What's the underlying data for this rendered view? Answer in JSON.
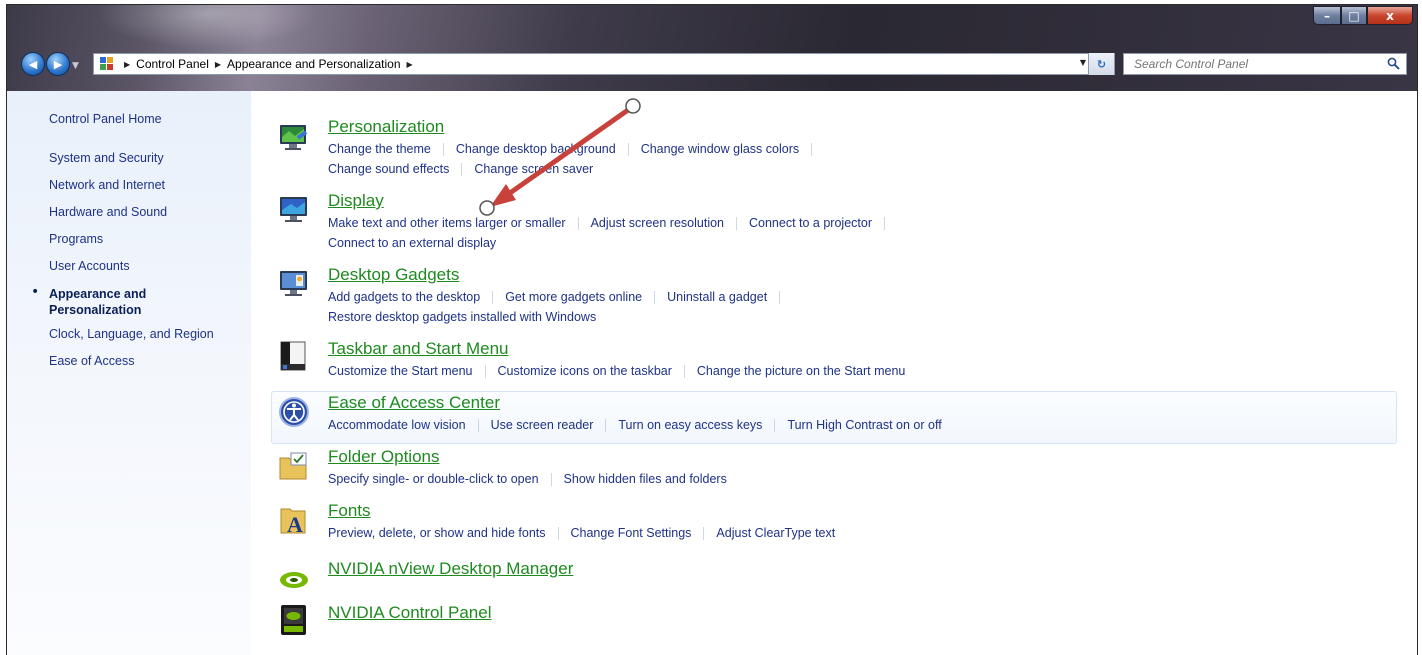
{
  "window": {
    "caption_buttons": {
      "minimize": "–",
      "maximize": "□",
      "close": "x"
    }
  },
  "nav": {
    "back_glyph": "◀",
    "forward_glyph": "▶",
    "breadcrumbs": [
      "Control Panel",
      "Appearance and Personalization"
    ],
    "refresh_glyph": "↻",
    "search_placeholder": "Search Control Panel"
  },
  "sidebar": {
    "items": [
      {
        "label": "Control Panel Home"
      },
      {
        "label": "System and Security"
      },
      {
        "label": "Network and Internet"
      },
      {
        "label": "Hardware and Sound"
      },
      {
        "label": "Programs"
      },
      {
        "label": "User Accounts"
      },
      {
        "label_line1": "Appearance and",
        "label_line2": "Personalization",
        "current": true
      },
      {
        "label": "Clock, Language, and Region"
      },
      {
        "label": "Ease of Access"
      }
    ],
    "bullet": "•"
  },
  "categories": [
    {
      "title": "Personalization",
      "icon": "personalization-icon",
      "links_row1": [
        "Change the theme",
        "Change desktop background",
        "Change window glass colors"
      ],
      "links_row2": [
        "Change sound effects",
        "Change screen saver"
      ]
    },
    {
      "title": "Display",
      "icon": "display-icon",
      "links_row1": [
        "Make text and other items larger or smaller",
        "Adjust screen resolution",
        "Connect to a projector"
      ],
      "links_row2": [
        "Connect to an external display"
      ]
    },
    {
      "title": "Desktop Gadgets",
      "icon": "gadgets-icon",
      "links_row1": [
        "Add gadgets to the desktop",
        "Get more gadgets online",
        "Uninstall a gadget"
      ],
      "links_row2": [
        "Restore desktop gadgets installed with Windows"
      ]
    },
    {
      "title": "Taskbar and Start Menu",
      "icon": "taskbar-icon",
      "links_row1": [
        "Customize the Start menu",
        "Customize icons on the taskbar",
        "Change the picture on the Start menu"
      ]
    },
    {
      "title": "Ease of Access Center",
      "icon": "ease-of-access-icon",
      "links_row1": [
        "Accommodate low vision",
        "Use screen reader",
        "Turn on easy access keys",
        "Turn High Contrast on or off"
      ]
    },
    {
      "title": "Folder Options",
      "icon": "folder-options-icon",
      "links_row1": [
        "Specify single- or double-click to open",
        "Show hidden files and folders"
      ]
    },
    {
      "title": "Fonts",
      "icon": "fonts-icon",
      "links_row1": [
        "Preview, delete, or show and hide fonts",
        "Change Font Settings",
        "Adjust ClearType text"
      ]
    },
    {
      "title": "NVIDIA nView Desktop Manager",
      "icon": "nvidia-nview-icon"
    },
    {
      "title": "NVIDIA Control Panel",
      "icon": "nvidia-control-panel-icon"
    }
  ],
  "colors": {
    "link": "#1e3287",
    "category_title": "#1f8a1f",
    "annotation_arrow": "#c8413a"
  }
}
